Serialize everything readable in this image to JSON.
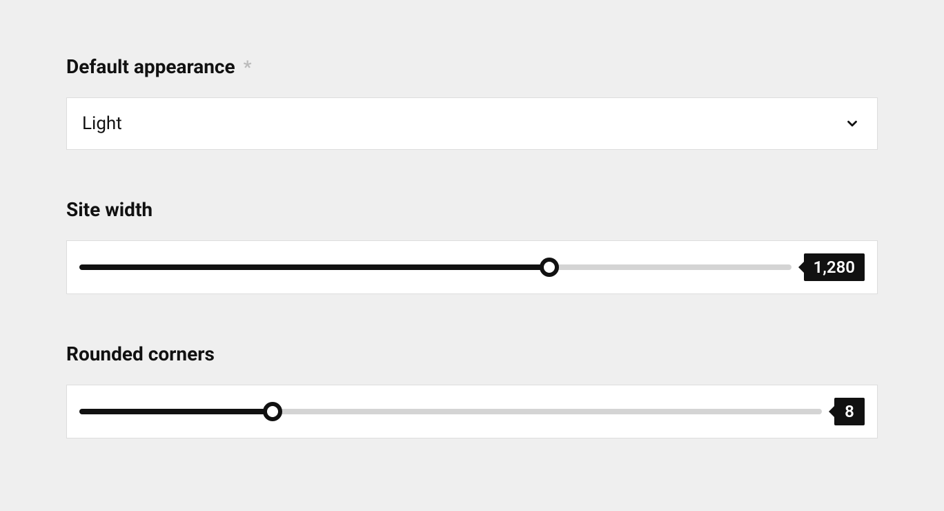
{
  "appearance": {
    "label": "Default appearance",
    "required_marker": "*",
    "value": "Light"
  },
  "site_width": {
    "label": "Site width",
    "value": 1280,
    "display": "1,280",
    "percent": 66
  },
  "rounded_corners": {
    "label": "Rounded corners",
    "value": 8,
    "display": "8",
    "percent": 26
  }
}
